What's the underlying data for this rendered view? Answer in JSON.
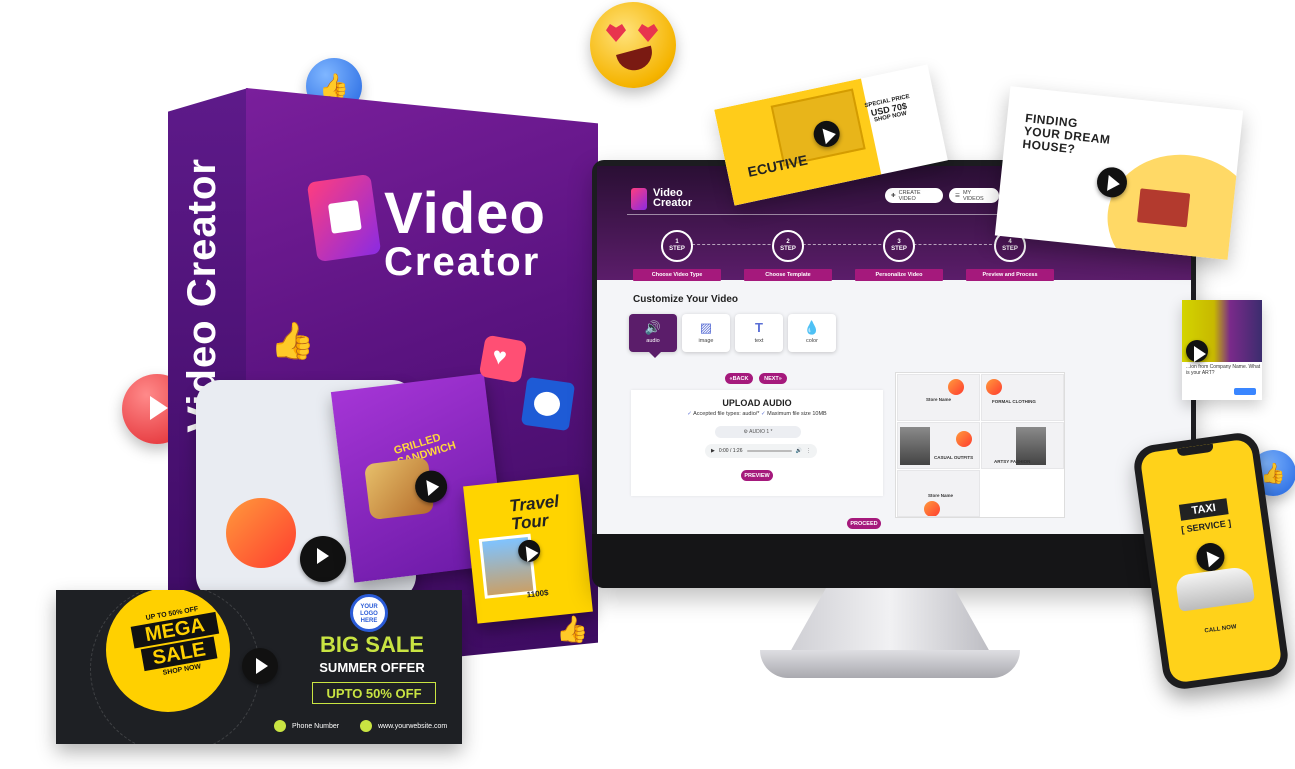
{
  "product": {
    "title_line1": "Video",
    "title_line2": "Creator",
    "side_title": "Video Creator"
  },
  "app": {
    "name_line1": "Video",
    "name_line2": "Creator",
    "create_video": "CREATE VIDEO",
    "my_videos": "MY VIDEOS",
    "steps": [
      {
        "num": "1",
        "word": "STEP",
        "label": "Choose Video Type"
      },
      {
        "num": "2",
        "word": "STEP",
        "label": "Choose Template"
      },
      {
        "num": "3",
        "word": "STEP",
        "label": "Personalize Video"
      },
      {
        "num": "4",
        "word": "STEP",
        "label": "Preview and Process"
      }
    ],
    "customize_title": "Customize Your Video",
    "tabs": [
      {
        "icon": "speaker-icon",
        "label": "audio"
      },
      {
        "icon": "image-icon",
        "label": "image"
      },
      {
        "icon": "text-icon",
        "label": "text"
      },
      {
        "icon": "drop-icon",
        "label": "color"
      }
    ],
    "back_label": "«BACK",
    "next_label": "NEXT»",
    "upload_title": "UPLOAD AUDIO",
    "accepted_types": "Accepted file types: audio/*",
    "max_size": "Maximum file size 10MB",
    "audio_select": "⚙ AUDIO 1 *",
    "player_time": "0:00 / 1:26",
    "preview_label": "PREVIEW",
    "proceed_label": "PROCEED",
    "templates": [
      {
        "label": "Store Name"
      },
      {
        "label": "FORMAL CLOTHING"
      },
      {
        "label": "CASUAL OUTFITS"
      },
      {
        "label": "ARTSY FASHION"
      },
      {
        "label": "Store Name"
      }
    ]
  },
  "cards": {
    "house_title": "FINDING YOUR DREAM HOUSE?",
    "price_label": "SPECIAL PRICE",
    "price_value": "USD 70$",
    "shop_now": "SHOP NOW",
    "executive": "ECUTIVE",
    "mini_text": "...ion from Company Name. What is your ART?",
    "sandwich": "GRILLED SANDWICH",
    "travel": "Travel Tour",
    "travel_price": "1100$",
    "taxi": "TAXI",
    "service": "[ SERVICE ]",
    "call_now": "CALL NOW"
  },
  "banner": {
    "upto_top": "UP TO 50% OFF",
    "mega": "MEGA",
    "sale": "SALE",
    "shop_now": "SHOP NOW",
    "logo": "YOUR LOGO HERE",
    "big_sale": "BIG SALE",
    "summer": "SUMMER OFFER",
    "upto": "UPTO 50% OFF",
    "phone": "Phone Number",
    "website": "www.yourwebsite.com"
  }
}
